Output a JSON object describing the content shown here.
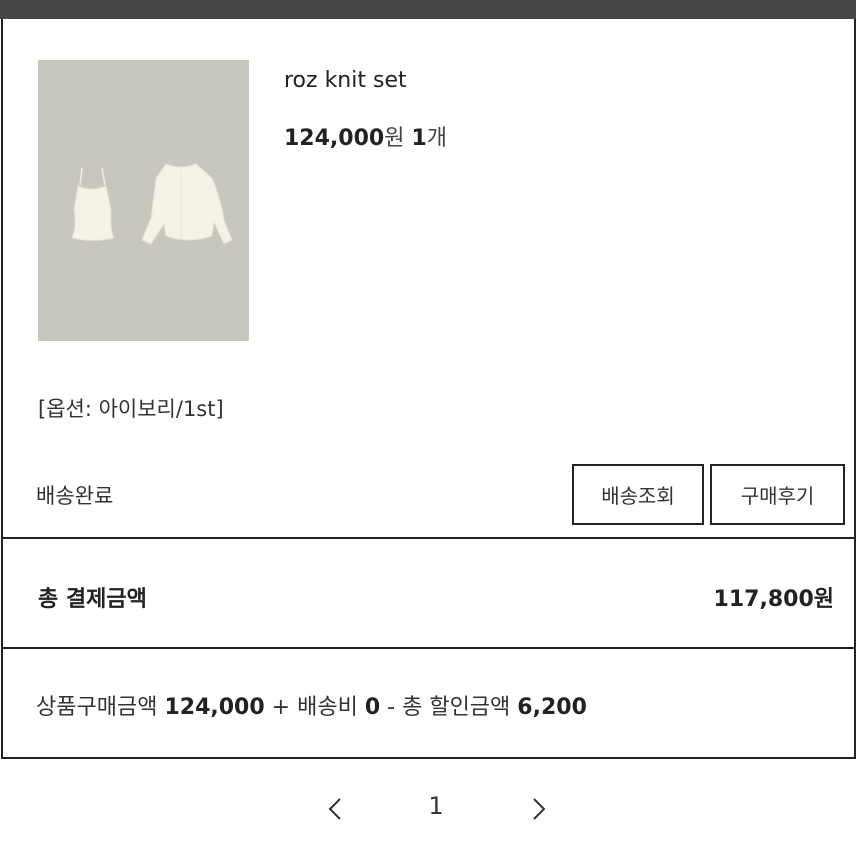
{
  "order": {
    "product_name": "roz knit set",
    "price": "124,000",
    "price_unit": "원",
    "quantity": "1",
    "quantity_unit": "개",
    "option": "[옵션: 아이보리/1st]",
    "status": "배송완료",
    "buttons": {
      "track": "배송조회",
      "review": "구매후기"
    }
  },
  "payment": {
    "total_label": "총 결제금액",
    "total_value": "117,800원",
    "breakdown": {
      "product_label": "상품구매금액",
      "product_amount": "124,000",
      "plus": "+",
      "shipping_label": "배송비",
      "shipping_amount": "0",
      "minus": "-",
      "discount_label": "총 할인금액",
      "discount_amount": "6,200"
    }
  },
  "pagination": {
    "current_page": "1",
    "prev_icon": "chevron-left-icon",
    "next_icon": "chevron-right-icon"
  },
  "colors": {
    "topbar": "#464646",
    "border": "#222222",
    "thumb_bg": "#c8c7bd",
    "garment": "#f4f1e6"
  }
}
